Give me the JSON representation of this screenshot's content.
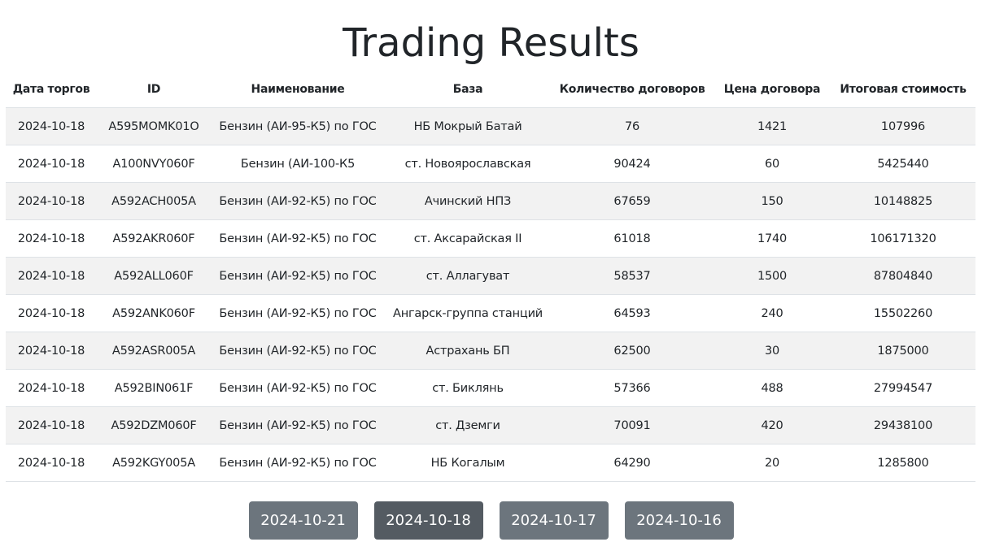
{
  "page": {
    "title": "Trading Results"
  },
  "table": {
    "columns": [
      "Дата торгов",
      "ID",
      "Наименование",
      "База",
      "Количество договоров",
      "Цена договора",
      "Итоговая стоимость"
    ],
    "rows": [
      [
        "2024-10-18",
        "A595MOMK01O",
        "Бензин (АИ-95-К5) по ГОС",
        "НБ Мокрый Батай",
        "76",
        "1421",
        "107996"
      ],
      [
        "2024-10-18",
        "A100NVY060F",
        "Бензин (АИ-100-К5",
        "ст. Новоярославская",
        "90424",
        "60",
        "5425440"
      ],
      [
        "2024-10-18",
        "A592ACH005A",
        "Бензин (АИ-92-К5) по ГОС",
        "Ачинский НПЗ",
        "67659",
        "150",
        "10148825"
      ],
      [
        "2024-10-18",
        "A592AKR060F",
        "Бензин (АИ-92-К5) по ГОС",
        "ст. Аксарайская II",
        "61018",
        "1740",
        "106171320"
      ],
      [
        "2024-10-18",
        "A592ALL060F",
        "Бензин (АИ-92-К5) по ГОС",
        "ст. Аллагуват",
        "58537",
        "1500",
        "87804840"
      ],
      [
        "2024-10-18",
        "A592ANK060F",
        "Бензин (АИ-92-К5) по ГОС",
        "Ангарск-группа станций",
        "64593",
        "240",
        "15502260"
      ],
      [
        "2024-10-18",
        "A592ASR005A",
        "Бензин (АИ-92-К5) по ГОС",
        "Астрахань БП",
        "62500",
        "30",
        "1875000"
      ],
      [
        "2024-10-18",
        "A592BIN061F",
        "Бензин (АИ-92-К5) по ГОС",
        "ст. Биклянь",
        "57366",
        "488",
        "27994547"
      ],
      [
        "2024-10-18",
        "A592DZM060F",
        "Бензин (АИ-92-К5) по ГОС",
        "ст. Дземги",
        "70091",
        "420",
        "29438100"
      ],
      [
        "2024-10-18",
        "A592KGY005A",
        "Бензин (АИ-92-К5) по ГОС",
        "НБ Когалым",
        "64290",
        "20",
        "1285800"
      ]
    ]
  },
  "pagination": {
    "dates": [
      "2024-10-21",
      "2024-10-18",
      "2024-10-17",
      "2024-10-16"
    ],
    "active": "2024-10-18"
  },
  "colors": {
    "button": "#6c757d",
    "button_active": "#545b62",
    "row_stripe": "#f2f2f2"
  }
}
